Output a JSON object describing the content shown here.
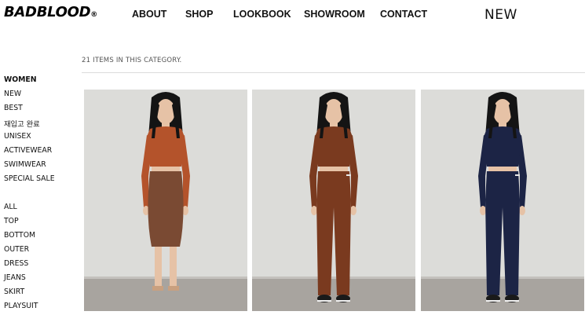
{
  "logo": {
    "text": "BADBLOOD",
    "mark": "®"
  },
  "nav": {
    "items": [
      "ABOUT",
      "SHOP",
      "LOOKBOOK",
      "SHOWROOM",
      "CONTACT"
    ],
    "new_label": "NEW"
  },
  "category_count": "21 ITEMS IN THIS CATEGORY.",
  "sidebar": {
    "heading": "WOMEN",
    "group1": [
      "NEW",
      "BEST",
      "재입고 완료",
      "UNISEX",
      "ACTIVEWEAR",
      "SWIMWEAR",
      "SPECIAL SALE"
    ],
    "group2": [
      "ALL",
      "TOP",
      "BOTTOM",
      "OUTER",
      "DRESS",
      "JEANS",
      "SKIRT",
      "PLAYSUIT"
    ]
  },
  "products": [
    {
      "top_color": "#b4532b",
      "bottom_color": "#7a4a33",
      "bottom_type": "skirt",
      "shoe_color": "#c9a07f"
    },
    {
      "top_color": "#7a3a1f",
      "bottom_color": "#7a3a1f",
      "bottom_type": "pants",
      "shoe_color": "#1a1a1a"
    },
    {
      "top_color": "#1c2445",
      "bottom_color": "#1c2445",
      "bottom_type": "pants",
      "shoe_color": "#1a1a1a"
    }
  ]
}
